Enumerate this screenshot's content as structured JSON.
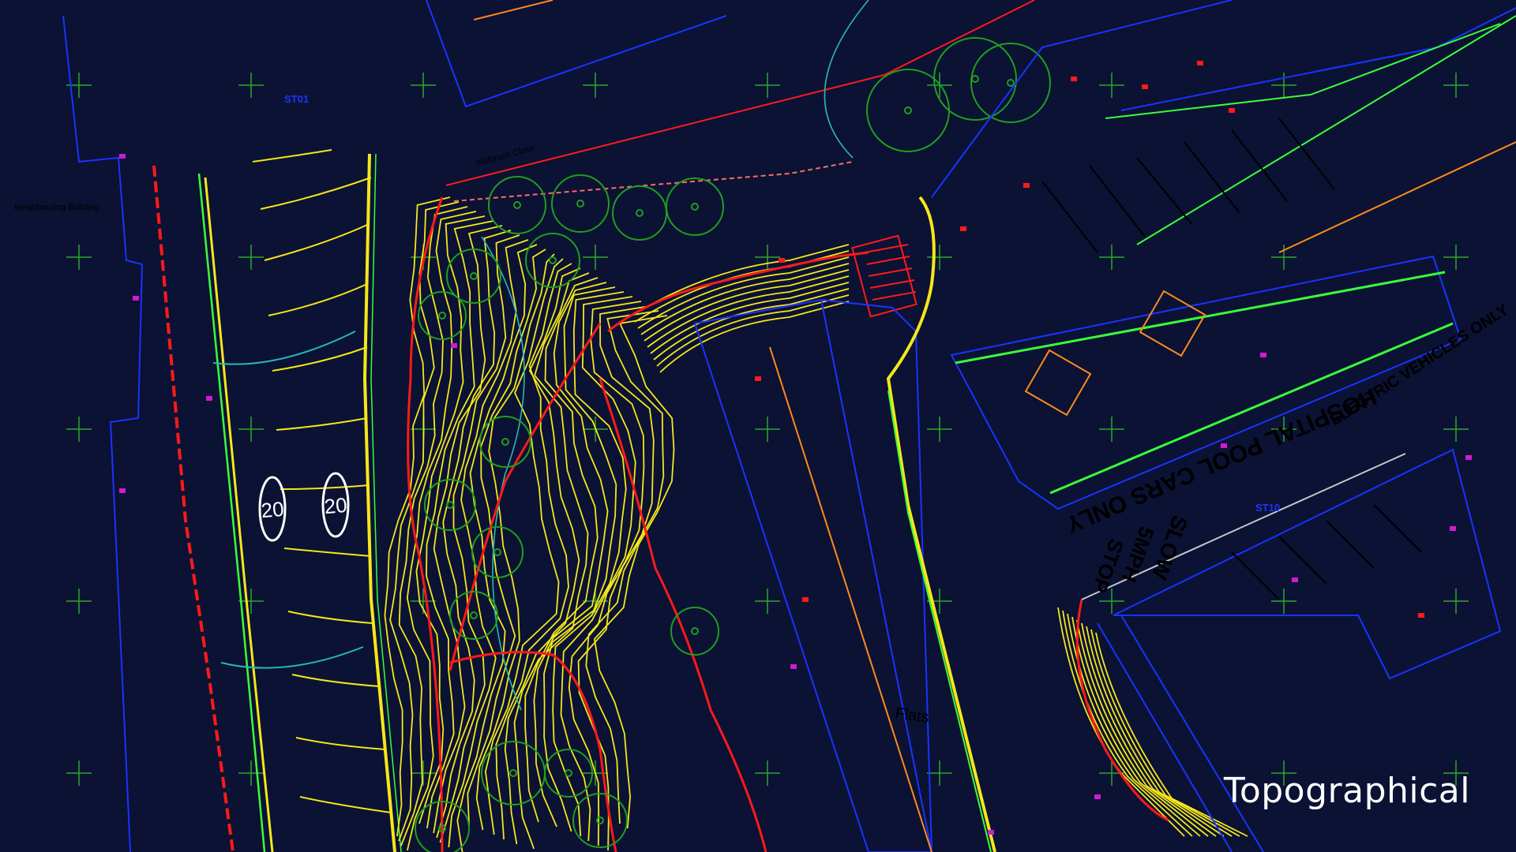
{
  "caption": "Topographical",
  "labels": {
    "neighbouring_building": "Neighbouring Building",
    "holbrook_close": "Holbrook Close",
    "station_st01": "ST01",
    "station_st10": "ST10",
    "flats": "Flats",
    "speed_limit": "20",
    "hospital_pool_cars": "HOSPITAL POOL CARS ONLY",
    "electric_vehicles": "ELECTRIC VEHICLES ONLY",
    "slow": "SLOW",
    "mph_5": "5MPH",
    "stop": "STOP"
  },
  "colors": {
    "background": "#0b1234",
    "contour_yellow": "#f5e71a",
    "boundary_red": "#ff1a1a",
    "tree_green": "#1f9e1f",
    "road_blue": "#1a33ff",
    "kerb_green": "#39ff3a",
    "cyan_line": "#28b8b8",
    "orange_line": "#ff8a1a",
    "magenta_mark": "#d11ad1",
    "white_text": "#ffffff"
  }
}
